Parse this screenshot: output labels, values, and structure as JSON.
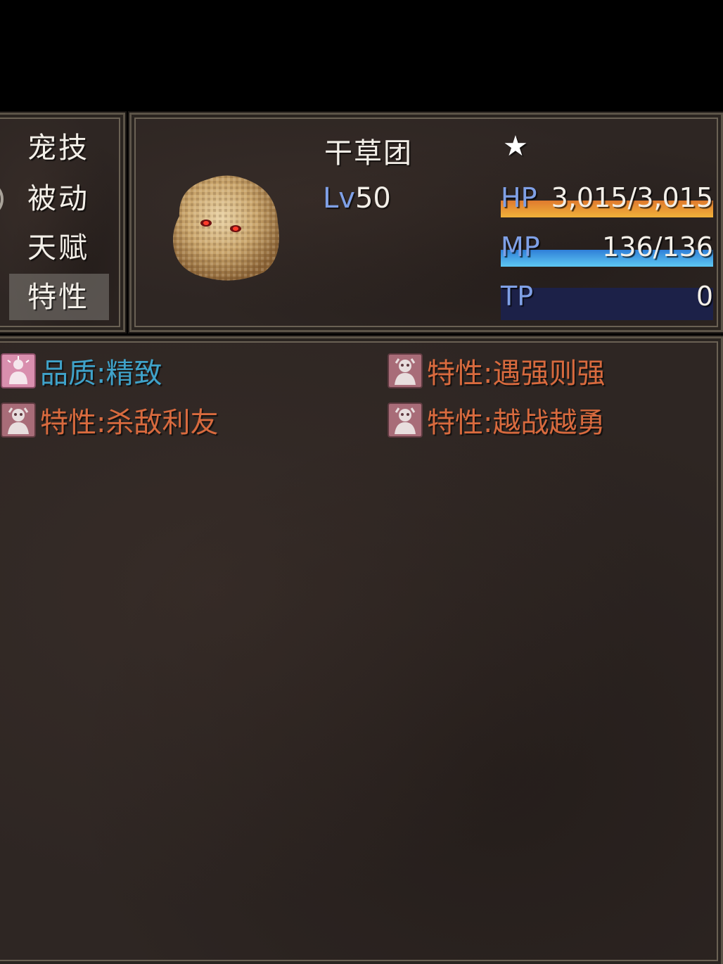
{
  "commands": [
    {
      "label": "宠技",
      "selected": false
    },
    {
      "label": "被动",
      "selected": false
    },
    {
      "label": "天赋",
      "selected": false
    },
    {
      "label": "特性",
      "selected": true
    }
  ],
  "pet": {
    "name": "干草团",
    "star": "★",
    "level_prefix": "Lv",
    "level": "50",
    "sprite_icon": "hay-ball-monster-sprite"
  },
  "gauges": {
    "hp": {
      "label": "HP",
      "value_text": "3,015/3,015",
      "fraction": 1.0,
      "color": "#e07a2e"
    },
    "mp": {
      "label": "MP",
      "value_text": "136/136",
      "fraction": 1.0,
      "color": "#3a9be0"
    },
    "tp": {
      "label": "TP",
      "value_text": "0",
      "fraction": 0.0,
      "color": "#4fbf50"
    }
  },
  "traits": [
    {
      "text": "品质:精致",
      "color": "#3fa2c9",
      "icon": "quality-person-icon"
    },
    {
      "text": "特性:遇强则强",
      "color": "#d86a3e",
      "icon": "trait-monster-icon"
    },
    {
      "text": "特性:杀敌利友",
      "color": "#d86a3e",
      "icon": "trait-monster-icon"
    },
    {
      "text": "特性:越战越勇",
      "color": "#d86a3e",
      "icon": "trait-monster-icon"
    }
  ]
}
